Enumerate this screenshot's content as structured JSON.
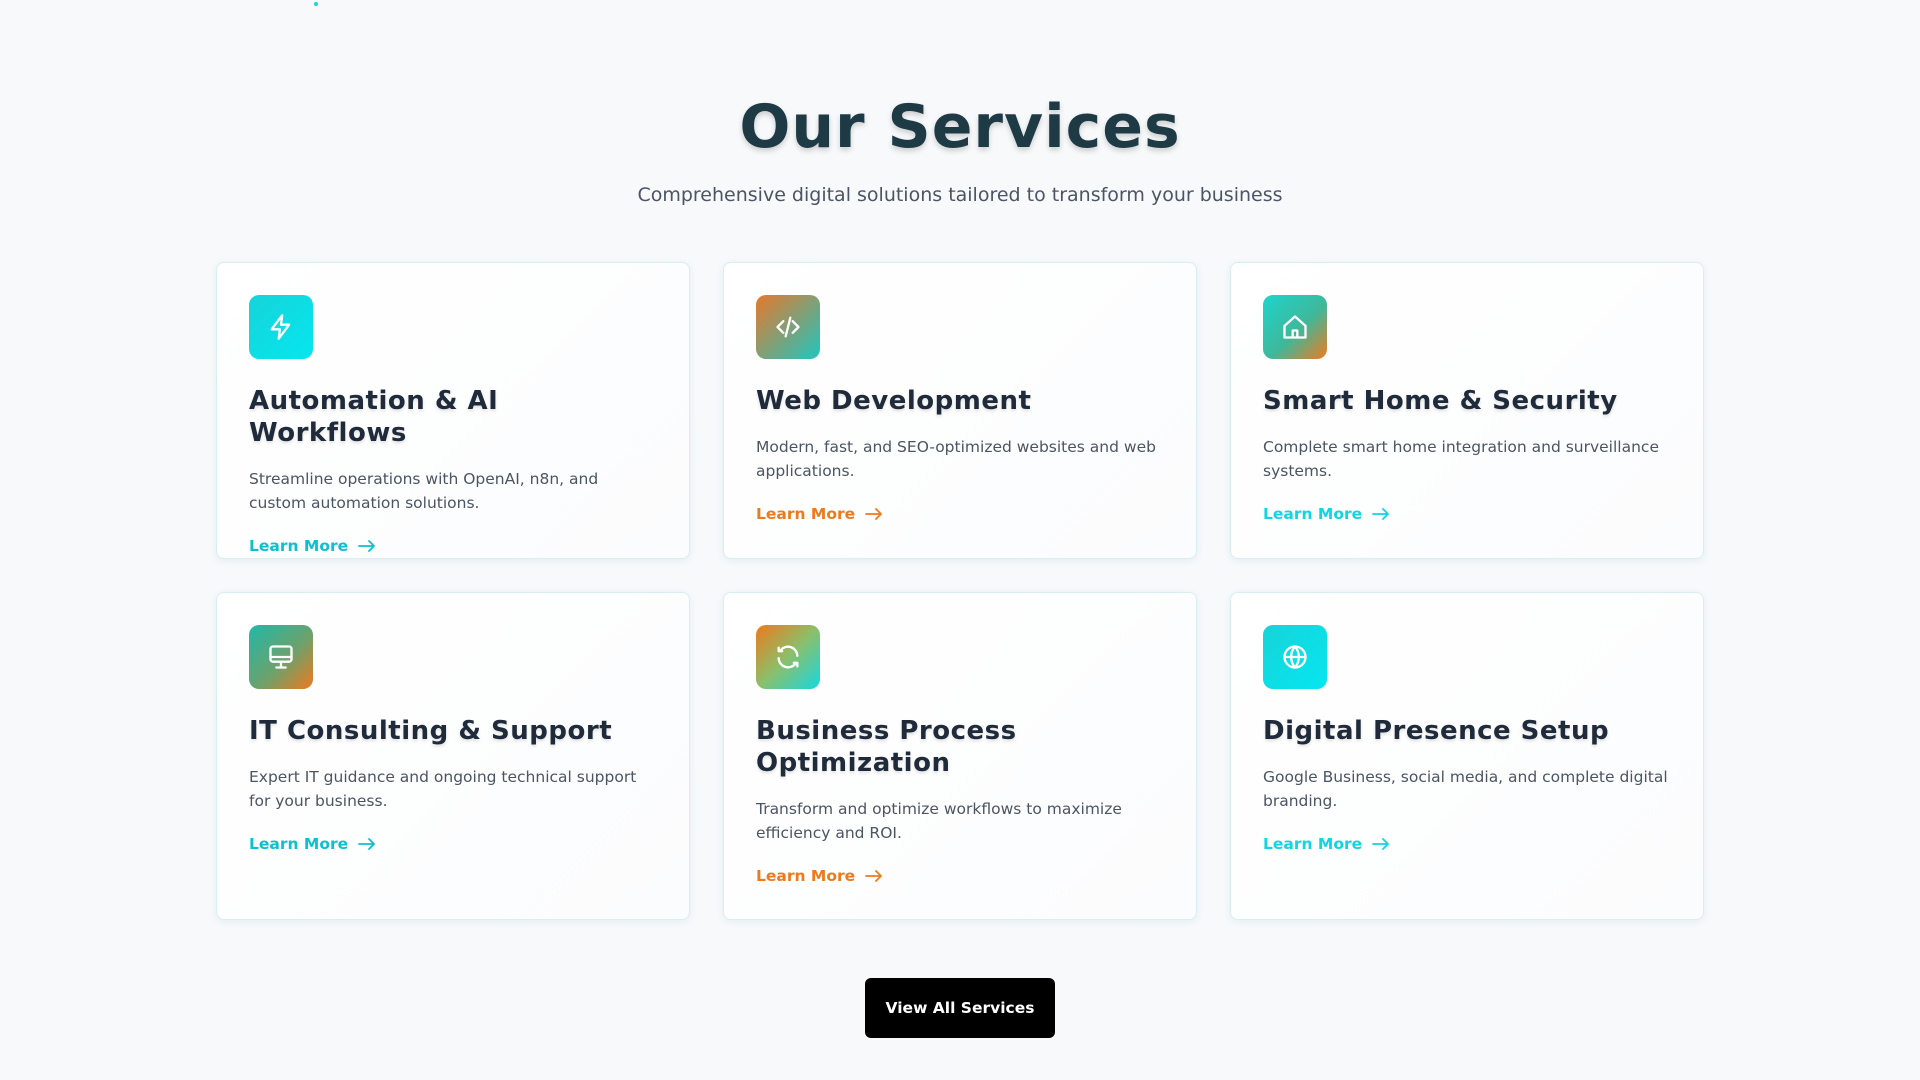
{
  "header": {
    "title": "Our Services",
    "subtitle": "Comprehensive digital solutions tailored to transform your business"
  },
  "services": [
    {
      "icon": "lightning-icon",
      "title": "Automation & AI Workflows",
      "description": "Streamline operations with OpenAI, n8n, and custom automation solutions.",
      "link": "Learn More",
      "link_color": "#0fbfcf"
    },
    {
      "icon": "code-icon",
      "title": "Web Development",
      "description": "Modern, fast, and SEO-optimized websites and web applications.",
      "link": "Learn More",
      "link_color": "#ee7a1c"
    },
    {
      "icon": "home-icon",
      "title": "Smart Home & Security",
      "description": "Complete smart home integration and surveillance systems.",
      "link": "Learn More",
      "link_color": "#14d3e3"
    },
    {
      "icon": "monitor-icon",
      "title": "IT Consulting & Support",
      "description": "Expert IT guidance and ongoing technical support for your business.",
      "link": "Learn More",
      "link_color": "#0fbfcf"
    },
    {
      "icon": "refresh-icon",
      "title": "Business Process Optimization",
      "description": "Transform and optimize workflows to maximize efficiency and ROI.",
      "link": "Learn More",
      "link_color": "#ee7a1c"
    },
    {
      "icon": "globe-icon",
      "title": "Digital Presence Setup",
      "description": "Google Business, social media, and complete digital branding.",
      "link": "Learn More",
      "link_color": "#14d3e3"
    }
  ],
  "footer": {
    "button_label": "View All Services"
  },
  "colors": {
    "accent_cyan": "#14d3e3",
    "accent_orange": "#ee7a1c",
    "heading": "#1e3a45"
  }
}
